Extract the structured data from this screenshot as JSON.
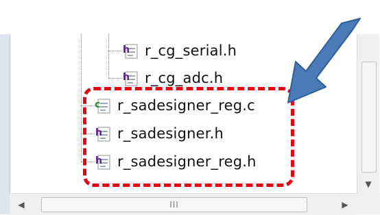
{
  "tree": {
    "files": [
      {
        "label": "r_cg_serial.h",
        "icon": "header-file-icon"
      },
      {
        "label": "r_cg_adc.h",
        "icon": "header-file-icon"
      },
      {
        "label": "r_sadesigner_reg.c",
        "icon": "c-source-file-icon"
      },
      {
        "label": "r_sadesigner.h",
        "icon": "header-file-icon"
      },
      {
        "label": "r_sadesigner_reg.h",
        "icon": "header-file-icon"
      }
    ]
  },
  "scrollbar": {
    "horizontal_grip": "III",
    "left_arrow": "◀",
    "right_arrow": "▶",
    "down_arrow": "▼"
  },
  "annotation": {
    "highlight_color": "#e30613",
    "arrow_color": "#4a7ab8"
  }
}
